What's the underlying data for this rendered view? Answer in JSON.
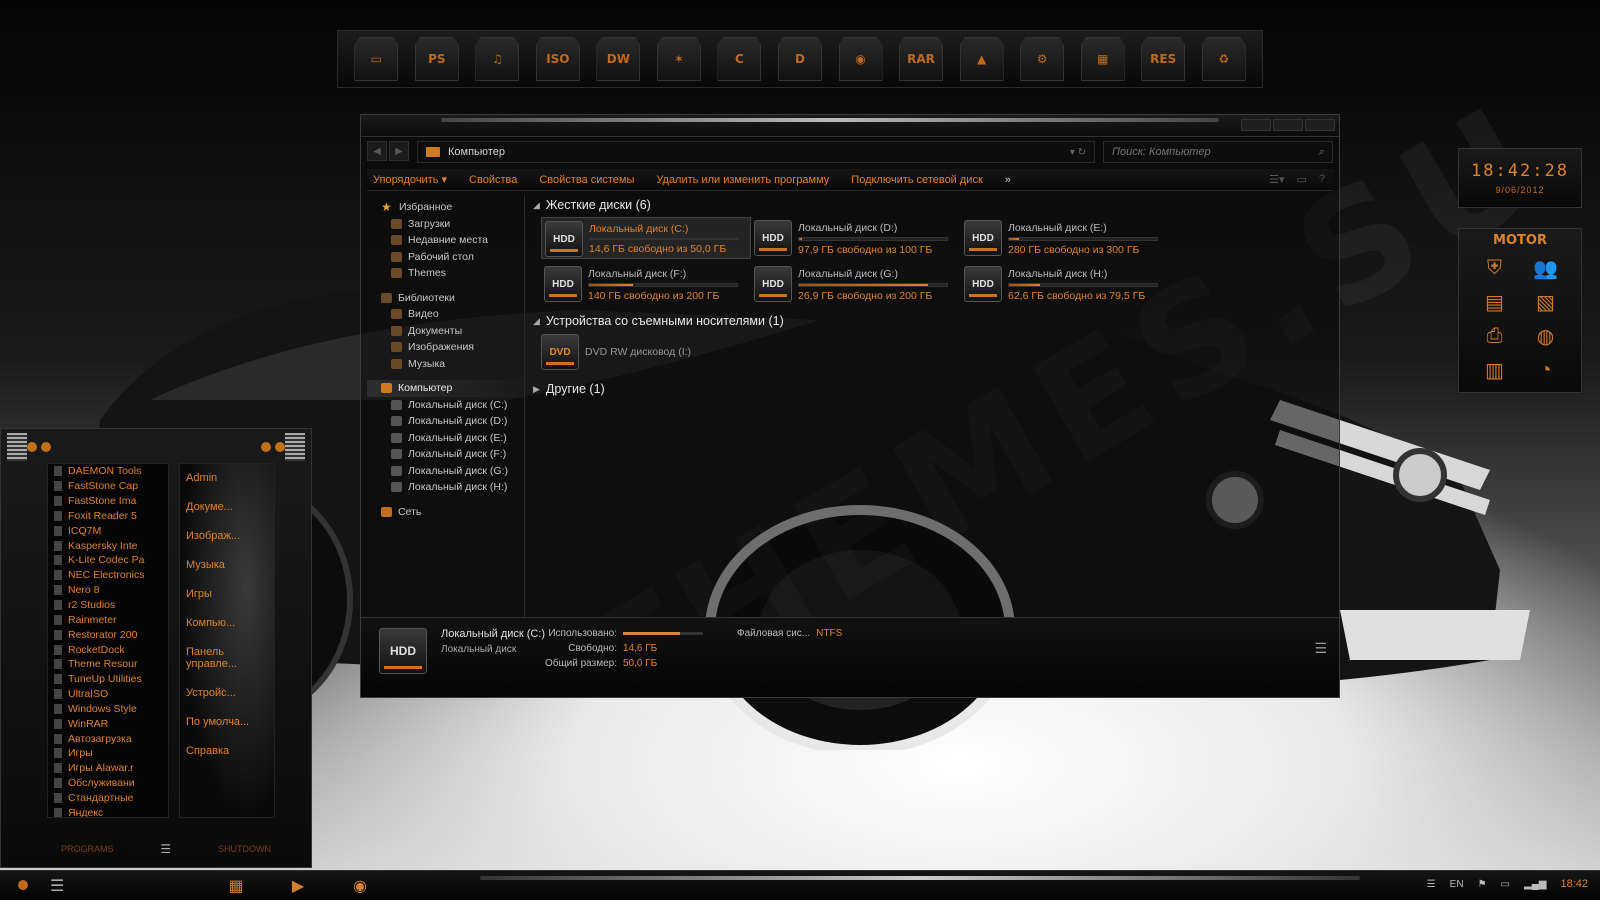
{
  "dock": {
    "items": [
      {
        "name": "computer",
        "glyph": "▭"
      },
      {
        "name": "photoshop",
        "glyph": "PS"
      },
      {
        "name": "music",
        "glyph": "♫"
      },
      {
        "name": "iso",
        "glyph": "ISO"
      },
      {
        "name": "dreamweaver",
        "glyph": "DW"
      },
      {
        "name": "starfish",
        "glyph": "✶"
      },
      {
        "name": "drive-c",
        "glyph": "C"
      },
      {
        "name": "drive-d",
        "glyph": "D"
      },
      {
        "name": "firefox",
        "glyph": "◉"
      },
      {
        "name": "winrar",
        "glyph": "RAR"
      },
      {
        "name": "vlc",
        "glyph": "▲"
      },
      {
        "name": "settings",
        "glyph": "⚙"
      },
      {
        "name": "package",
        "glyph": "▦"
      },
      {
        "name": "res",
        "glyph": "RES"
      },
      {
        "name": "recycle",
        "glyph": "♻"
      }
    ]
  },
  "explorer": {
    "address": "Компьютер",
    "search_placeholder": "Поиск: Компьютер",
    "toolbar": [
      "Упорядочить ▾",
      "Свойства",
      "Свойства системы",
      "Удалить или изменить программу",
      "Подключить сетевой диск"
    ],
    "toolbar_more": "»",
    "nav": {
      "favorites": "Избранное",
      "favorites_items": [
        "Загрузки",
        "Недавние места",
        "Рабочий стол",
        "Themes"
      ],
      "libraries": "Библиотеки",
      "libraries_items": [
        "Видео",
        "Документы",
        "Изображения",
        "Музыка"
      ],
      "computer": "Компьютер",
      "computer_items": [
        "Локальный диск (C:)",
        "Локальный диск (D:)",
        "Локальный диск (E:)",
        "Локальный диск (F:)",
        "Локальный диск (G:)",
        "Локальный диск (H:)"
      ],
      "network": "Сеть"
    },
    "groups": {
      "hard_disks": "Жесткие диски (6)",
      "removable": "Устройства со съемными носителями (1)",
      "other": "Другие (1)"
    },
    "drives": [
      {
        "name": "Локальный диск (C:)",
        "free": "14,6 ГБ свободно из 50,0 ГБ",
        "used_fraction": 0.71,
        "active": true
      },
      {
        "name": "Локальный диск (D:)",
        "free": "97,9 ГБ свободно из 100 ГБ",
        "used_fraction": 0.02,
        "active": false
      },
      {
        "name": "Локальный диск (E:)",
        "free": "280 ГБ свободно из 300 ГБ",
        "used_fraction": 0.07,
        "active": false
      },
      {
        "name": "Локальный диск (F:)",
        "free": "140 ГБ свободно из 200 ГБ",
        "used_fraction": 0.3,
        "active": false
      },
      {
        "name": "Локальный диск (G:)",
        "free": "26,9 ГБ свободно из 200 ГБ",
        "used_fraction": 0.87,
        "active": false
      },
      {
        "name": "Локальный диск (H:)",
        "free": "62,6 ГБ свободно из 79,5 ГБ",
        "used_fraction": 0.21,
        "active": false
      }
    ],
    "drive_icon_label": "HDD",
    "dvd": {
      "icon_label": "DVD",
      "name": "DVD RW дисковод (I:)"
    },
    "details": {
      "name": "Локальный диск (C:)",
      "type": "Локальный диск",
      "used_label": "Использовано:",
      "used_fraction": 0.71,
      "free_label": "Свободно:",
      "free_value": "14,6 ГБ",
      "total_label": "Общий размер:",
      "total_value": "50,0 ГБ",
      "fs_label": "Файловая сис...",
      "fs_value": "NTFS"
    }
  },
  "clock": {
    "time": "18:42:28",
    "date": "9/06/2012"
  },
  "motor": {
    "title": "MOTOR",
    "icons": [
      "shield-icon",
      "users-icon",
      "folder-icon",
      "document-icon",
      "printer-icon",
      "globe-icon",
      "archive-icon",
      "gauge-icon"
    ]
  },
  "start_menu": {
    "programs": [
      "DAEMON Tools",
      "FastStone Cap",
      "FastStone Ima",
      "Foxit Reader 5",
      "ICQ7M",
      "Kaspersky Inte",
      "K-Lite Codec Pa",
      "NEC Electronics",
      "Nero 8",
      "r2 Studios",
      "Rainmeter",
      "Restorator 200",
      "RocketDock",
      "Theme Resour",
      "TuneUp Utilities",
      "UltraISO",
      "Windows Style",
      "WinRAR",
      "Автозагрузка",
      "Игры",
      "Игры Alawar.r",
      "Обслуживани",
      "Стандартные",
      "Яндекс"
    ],
    "links": [
      "Admin",
      "Докуме...",
      "Изображ...",
      "Музыка",
      "Игры",
      "Компью...",
      "Панель управле...",
      "Устройс...",
      "По умолча...",
      "Справка"
    ],
    "bottom_left": "PROGRAMS",
    "bottom_right": "SHUTDOWN"
  },
  "taskbar": {
    "lang": "EN",
    "time": "18:42"
  }
}
